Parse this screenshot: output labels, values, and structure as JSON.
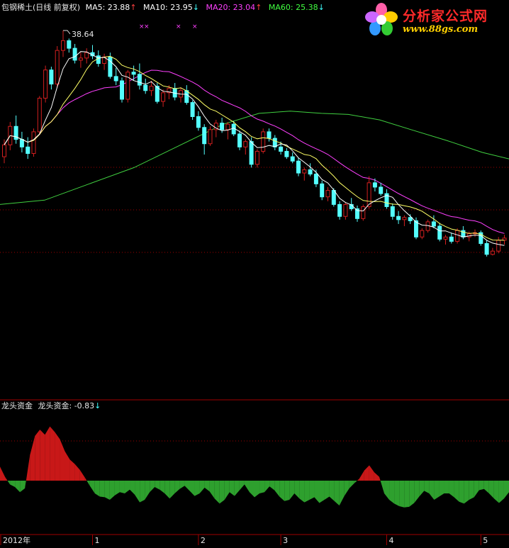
{
  "header": {
    "stock": "包钢稀土(日线 前复权)",
    "ma": [
      {
        "label": "MA5: 23.88",
        "arrow": "↑",
        "color": "#ffffff",
        "arrow_color": "#ff4040"
      },
      {
        "label": "MA10: 23.95",
        "arrow": "↓",
        "color": "#ffffff",
        "arrow_color": "#40ffff"
      },
      {
        "label": "MA20: 23.04",
        "arrow": "↑",
        "color": "#ff40ff",
        "arrow_color": "#ff4040"
      },
      {
        "label": "MA60: 25.38",
        "arrow": "↓",
        "color": "#40ff40",
        "arrow_color": "#40ffff"
      }
    ]
  },
  "logo": {
    "name": "分析家公式网",
    "url": "www.88gs.com"
  },
  "indicator": {
    "name": "龙头资金",
    "label": "龙头资金: -0.83",
    "arrow": "↓"
  },
  "colors": {
    "up": "#d21f1f",
    "down": "#54ffff",
    "ma5": "#ffffff",
    "ma10": "#ffff66",
    "ma20": "#ff40ff",
    "ma60": "#40d040",
    "pos": "#c81818",
    "neg": "#2ea02e",
    "axis_red": "#a00000",
    "grid": "#a00000"
  },
  "chart_data": {
    "type": "candlestick",
    "high_label": "38.64",
    "x_labels": [
      {
        "i": 0,
        "label": "2012年"
      },
      {
        "i": 15,
        "label": "1"
      },
      {
        "i": 33,
        "label": "2"
      },
      {
        "i": 47,
        "label": "3"
      },
      {
        "i": 65,
        "label": "4"
      },
      {
        "i": 81,
        "label": "5"
      }
    ],
    "ohlc": [
      [
        27.0,
        28.6,
        26.4,
        28.1
      ],
      [
        28.1,
        30.2,
        27.6,
        29.8
      ],
      [
        29.8,
        30.8,
        28.2,
        28.6
      ],
      [
        28.6,
        29.3,
        27.4,
        27.9
      ],
      [
        27.9,
        28.8,
        26.8,
        27.3
      ],
      [
        27.3,
        29.6,
        27.0,
        29.3
      ],
      [
        29.3,
        32.6,
        29.0,
        32.4
      ],
      [
        32.4,
        35.4,
        32.0,
        35.0
      ],
      [
        35.0,
        35.3,
        33.2,
        33.7
      ],
      [
        33.7,
        37.2,
        33.4,
        36.8
      ],
      [
        36.8,
        38.64,
        36.2,
        37.7
      ],
      [
        37.7,
        37.9,
        36.6,
        37.0
      ],
      [
        37.0,
        37.4,
        35.6,
        35.9
      ],
      [
        35.9,
        36.6,
        35.2,
        36.1
      ],
      [
        36.1,
        37.0,
        35.6,
        36.6
      ],
      [
        36.6,
        37.3,
        36.0,
        36.3
      ],
      [
        36.3,
        36.8,
        35.3,
        35.6
      ],
      [
        35.6,
        36.5,
        35.0,
        36.2
      ],
      [
        36.2,
        36.6,
        34.2,
        34.4
      ],
      [
        34.4,
        35.2,
        33.6,
        34.0
      ],
      [
        34.0,
        34.3,
        32.0,
        32.3
      ],
      [
        32.3,
        35.0,
        32.0,
        34.8
      ],
      [
        34.8,
        35.4,
        34.0,
        34.6
      ],
      [
        34.6,
        35.6,
        33.2,
        33.6
      ],
      [
        33.6,
        34.2,
        32.8,
        33.1
      ],
      [
        33.1,
        34.0,
        32.6,
        33.5
      ],
      [
        33.5,
        33.8,
        31.9,
        32.1
      ],
      [
        32.1,
        33.2,
        31.6,
        32.9
      ],
      [
        32.9,
        33.6,
        32.3,
        33.3
      ],
      [
        33.3,
        33.8,
        32.2,
        32.5
      ],
      [
        32.5,
        33.4,
        32.0,
        33.1
      ],
      [
        33.1,
        33.6,
        31.8,
        32.0
      ],
      [
        32.0,
        32.2,
        30.4,
        30.7
      ],
      [
        30.7,
        31.2,
        29.4,
        29.7
      ],
      [
        29.7,
        30.0,
        27.2,
        28.2
      ],
      [
        28.2,
        29.8,
        28.0,
        29.5
      ],
      [
        29.5,
        30.4,
        28.8,
        30.1
      ],
      [
        30.1,
        30.6,
        29.2,
        29.5
      ],
      [
        29.5,
        30.2,
        28.6,
        30.0
      ],
      [
        30.0,
        30.3,
        28.9,
        29.1
      ],
      [
        29.1,
        29.4,
        27.6,
        27.9
      ],
      [
        27.9,
        28.6,
        27.2,
        28.4
      ],
      [
        28.4,
        28.8,
        26.0,
        26.3
      ],
      [
        26.3,
        27.7,
        26.0,
        27.5
      ],
      [
        27.5,
        29.6,
        27.3,
        29.3
      ],
      [
        29.3,
        29.6,
        28.4,
        28.7
      ],
      [
        28.7,
        29.0,
        27.6,
        27.9
      ],
      [
        27.9,
        28.4,
        27.2,
        27.5
      ],
      [
        27.5,
        27.8,
        26.8,
        27.0
      ],
      [
        27.0,
        27.4,
        26.4,
        26.6
      ],
      [
        26.6,
        26.9,
        25.2,
        25.5
      ],
      [
        25.5,
        26.0,
        24.8,
        25.8
      ],
      [
        25.8,
        26.4,
        25.2,
        25.4
      ],
      [
        25.4,
        25.8,
        24.2,
        24.5
      ],
      [
        24.5,
        24.8,
        23.0,
        23.3
      ],
      [
        23.3,
        24.2,
        22.9,
        23.9
      ],
      [
        23.9,
        24.1,
        22.4,
        22.6
      ],
      [
        22.6,
        22.9,
        21.2,
        21.5
      ],
      [
        21.5,
        22.8,
        21.2,
        22.6
      ],
      [
        22.6,
        23.2,
        22.0,
        22.2
      ],
      [
        22.2,
        22.5,
        21.0,
        21.3
      ],
      [
        21.3,
        22.6,
        21.1,
        22.4
      ],
      [
        22.4,
        25.2,
        22.2,
        24.6
      ],
      [
        24.6,
        25.0,
        23.8,
        24.2
      ],
      [
        24.2,
        24.6,
        23.4,
        23.6
      ],
      [
        23.6,
        24.0,
        22.2,
        22.4
      ],
      [
        22.4,
        22.7,
        21.2,
        21.5
      ],
      [
        21.5,
        22.0,
        20.8,
        21.2
      ],
      [
        21.2,
        21.6,
        20.6,
        21.4
      ],
      [
        21.4,
        21.7,
        20.8,
        21.1
      ],
      [
        21.1,
        21.4,
        19.4,
        19.6
      ],
      [
        19.6,
        20.4,
        19.4,
        20.2
      ],
      [
        20.2,
        21.2,
        20.0,
        21.0
      ],
      [
        21.0,
        21.6,
        20.4,
        20.6
      ],
      [
        20.6,
        20.9,
        19.2,
        19.4
      ],
      [
        19.4,
        19.8,
        18.9,
        19.6
      ],
      [
        19.6,
        20.0,
        19.0,
        19.2
      ],
      [
        19.2,
        20.4,
        19.0,
        20.2
      ],
      [
        20.2,
        20.6,
        19.4,
        19.6
      ],
      [
        19.6,
        20.1,
        19.2,
        19.9
      ],
      [
        19.9,
        20.3,
        19.6,
        20.0
      ],
      [
        20.0,
        20.2,
        18.8,
        19.0
      ],
      [
        19.0,
        19.3,
        17.8,
        18.0
      ],
      [
        18.0,
        18.6,
        17.9,
        18.3
      ],
      [
        18.3,
        19.6,
        18.1,
        19.3
      ],
      [
        19.3,
        19.8,
        18.9,
        19.5
      ]
    ],
    "ma60": [
      [
        0,
        22.6
      ],
      [
        10,
        23.0
      ],
      [
        20,
        24.5
      ],
      [
        30,
        26.0
      ],
      [
        40,
        28.0
      ],
      [
        50,
        30.0
      ],
      [
        58,
        31.0
      ],
      [
        65,
        31.2
      ],
      [
        72,
        31.0
      ],
      [
        78,
        30.9
      ],
      [
        85,
        30.4
      ],
      [
        92,
        29.5
      ],
      [
        100,
        28.5
      ],
      [
        108,
        27.4
      ],
      [
        114,
        26.8
      ]
    ],
    "indicator_values": [
      2.2,
      0.6,
      -0.6,
      -1.0,
      -1.8,
      -1.2,
      4.0,
      7.0,
      8.0,
      7.2,
      8.5,
      7.6,
      6.5,
      4.6,
      3.3,
      2.6,
      1.7,
      0.5,
      -0.8,
      -2.0,
      -2.5,
      -2.6,
      -3.0,
      -2.3,
      -1.8,
      -2.0,
      -1.4,
      -2.2,
      -3.4,
      -3.0,
      -1.8,
      -1.0,
      -1.4,
      -2.0,
      -2.8,
      -2.0,
      -1.3,
      -0.8,
      -1.6,
      -2.4,
      -2.0,
      -1.1,
      -1.7,
      -2.8,
      -3.6,
      -3.0,
      -1.8,
      -2.4,
      -1.5,
      -0.6,
      -1.8,
      -2.6,
      -2.0,
      -1.8,
      -0.9,
      -1.5,
      -2.5,
      -3.2,
      -3.0,
      -2.0,
      -2.8,
      -3.4,
      -3.0,
      -2.6,
      -3.5,
      -3.0,
      -2.5,
      -3.2,
      -3.9,
      -2.4,
      -1.2,
      -0.4,
      0.3,
      1.6,
      2.4,
      1.3,
      0.6,
      -2.0,
      -3.0,
      -3.6,
      -4.0,
      -4.2,
      -4.1,
      -3.5,
      -2.5,
      -1.6,
      -2.0,
      -3.0,
      -2.5,
      -2.0,
      -2.0,
      -2.6,
      -3.3,
      -3.6,
      -3.0,
      -2.6,
      -1.5,
      -1.3,
      -2.0,
      -2.8,
      -3.5,
      -2.8,
      -1.8
    ]
  }
}
